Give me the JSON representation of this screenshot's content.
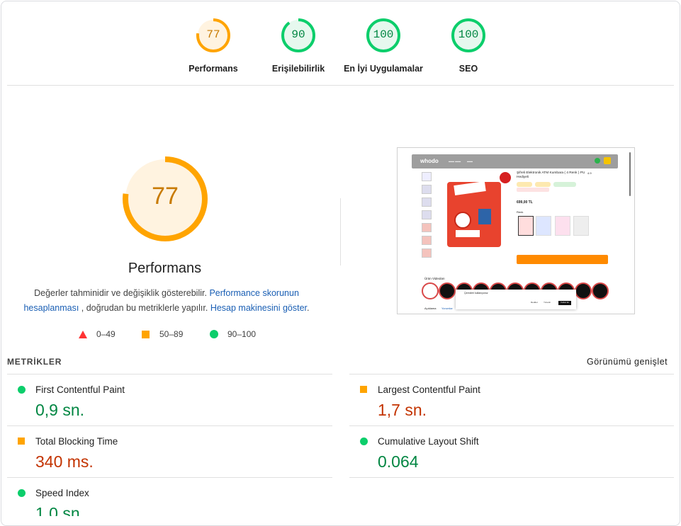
{
  "gauges": [
    {
      "score": "77",
      "label": "Performans",
      "color": "#ffa400",
      "bg": "#fff3e0",
      "fill": 0.77
    },
    {
      "score": "90",
      "label": "Erişilebilirlik",
      "color": "#0cce6b",
      "bg": "#e6f8ee",
      "fill": 0.9
    },
    {
      "score": "100",
      "label": "En İyi Uygulamalar",
      "color": "#0cce6b",
      "bg": "#e6f8ee",
      "fill": 1.0
    },
    {
      "score": "100",
      "label": "SEO",
      "color": "#0cce6b",
      "bg": "#e6f8ee",
      "fill": 1.0
    }
  ],
  "main": {
    "score": "77",
    "fill": 0.77,
    "title": "Performans",
    "desc_1": "Değerler tahminidir ve değişiklik gösterebilir. ",
    "desc_link_1": "Performance skorunun hesaplanması",
    "desc_2": " , doğrudan bu metriklerle yapılır. ",
    "desc_link_2": "Hesap makinesini göster",
    "desc_3": "."
  },
  "legend": [
    {
      "range": "0–49",
      "shape": "triangle",
      "color": "#ff3333"
    },
    {
      "range": "50–89",
      "shape": "square",
      "color": "#ffa400"
    },
    {
      "range": "90–100",
      "shape": "circle",
      "color": "#0cce6b"
    }
  ],
  "thumbnail": {
    "logo": "whodo",
    "product_title": "Şifreli Elektronik ATM Kumbara ( 4 Renk ) PU Hediyeli",
    "price": "699,00 TL",
    "rating": "4.9",
    "variants_label": "Renk",
    "variants": [
      "Kırmızı",
      "Mavi",
      "Pembe",
      "Siyah"
    ],
    "videos_label": "Ürün Videoları",
    "cookie_title": "Çerezleri kullanıyoruz",
    "cookie_buttons": [
      "Reddet",
      "Yönetin",
      "Kabul Et"
    ],
    "tab_label": "Açıklama",
    "tab_label_2": "Yorumlar"
  },
  "metrics": {
    "heading": "METRİKLER",
    "expand_label": "Görünümü genişlet",
    "items": [
      {
        "name": "First Contentful Paint",
        "value": "0,9 sn.",
        "status": "pass"
      },
      {
        "name": "Largest Contentful Paint",
        "value": "1,7 sn.",
        "status": "average"
      },
      {
        "name": "Total Blocking Time",
        "value": "340 ms.",
        "status": "average"
      },
      {
        "name": "Cumulative Layout Shift",
        "value": "0.064",
        "status": "pass"
      },
      {
        "name": "Speed Index",
        "value": "1,0 sn.",
        "status": "pass"
      }
    ]
  }
}
